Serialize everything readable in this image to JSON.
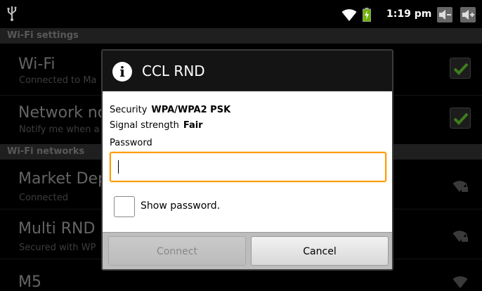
{
  "status_bar": {
    "time": "1:19 pm",
    "icons": [
      "usb-icon",
      "wifi-icon",
      "battery-charging-icon",
      "volume-down-icon",
      "volume-up-icon"
    ]
  },
  "settings": {
    "wifi_settings_header": "Wi-Fi settings",
    "rows": [
      {
        "title": "Wi-Fi",
        "subtitle": "Connected to Ma",
        "checked": true
      },
      {
        "title": "Network no",
        "subtitle": "Notify me when a",
        "checked": true
      }
    ],
    "wifi_networks_header": "Wi-Fi networks",
    "networks": [
      {
        "title": "Market Dep",
        "subtitle": "Connected",
        "secured": true
      },
      {
        "title": "Multi RND",
        "subtitle": "Secured with WP",
        "secured": true
      },
      {
        "title": "M5",
        "subtitle": "",
        "secured": false
      }
    ]
  },
  "dialog": {
    "title": "CCL RND",
    "security_label": "Security",
    "security_value": "WPA/WPA2 PSK",
    "signal_label": "Signal strength",
    "signal_value": "Fair",
    "password_label": "Password",
    "password_value": "",
    "show_password_label": "Show password.",
    "show_password_checked": false,
    "connect_label": "Connect",
    "connect_enabled": false,
    "cancel_label": "Cancel"
  },
  "colors": {
    "focus_border": "#ff9c00",
    "check_green": "#5ec02a"
  }
}
